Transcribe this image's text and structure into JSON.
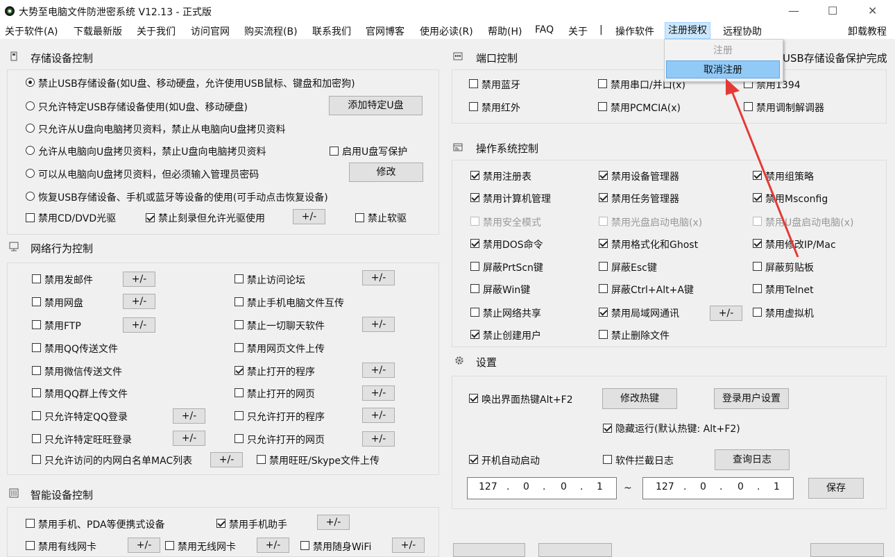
{
  "window": {
    "title": "大势至电脑文件防泄密系统 V12.13 - 正式版",
    "controls": {
      "minimize": "—",
      "maximize": "☐",
      "close": "✕"
    }
  },
  "menubar": {
    "items": [
      "关于软件(A)",
      "下载最新版",
      "关于我们",
      "访问官网",
      "购买流程(B)",
      "联系我们",
      "官网博客",
      "使用必读(R)",
      "帮助(H)",
      "FAQ",
      "关于",
      "|",
      "操作软件",
      "注册授权",
      "远程协助"
    ],
    "right_item": "卸载教程"
  },
  "dropdown": {
    "items": [
      "注册",
      "取消注册"
    ],
    "highlighted": "取消注册",
    "disabled": "注册"
  },
  "status_text": "USB存储设备保护完成",
  "storage": {
    "title": "存储设备控制",
    "radios": [
      "禁止USB存储设备(如U盘、移动硬盘，允许使用USB鼠标、键盘和加密狗)",
      "只允许特定USB存储设备使用(如U盘、移动硬盘)",
      "只允许从U盘向电脑拷贝资料，禁止从电脑向U盘拷贝资料",
      "允许从电脑向U盘拷贝资料，禁止U盘向电脑拷贝资料",
      "可以从电脑向U盘拷贝资料，但必须输入管理员密码",
      "恢复USB存储设备、手机或蓝牙等设备的使用(可手动点击恢复设备)"
    ],
    "add_usb_button": "添加特定U盘",
    "write_protect": "启用U盘写保护",
    "modify_button": "修改",
    "cd_dvd": "禁用CD/DVD光驱",
    "burn": "禁止刻录但允许光驱使用",
    "floppy": "禁止软驱",
    "plus_minus": "+/-"
  },
  "network": {
    "title": "网络行为控制",
    "left": [
      "禁用发邮件",
      "禁用网盘",
      "禁用FTP",
      "禁用QQ传送文件",
      "禁用微信传送文件",
      "禁用QQ群上传文件",
      "只允许特定QQ登录",
      "只允许特定旺旺登录",
      "只允许访问的内网白名单MAC列表"
    ],
    "right": [
      "禁止访问论坛",
      "禁止手机电脑文件互传",
      "禁止一切聊天软件",
      "禁用网页文件上传",
      "禁止打开的程序",
      "禁止打开的网页",
      "只允许打开的程序",
      "只允许打开的网页",
      "禁用旺旺/Skype文件上传"
    ]
  },
  "smart": {
    "title": "智能设备控制",
    "row1": [
      "禁用手机、PDA等便携式设备",
      "禁用手机助手"
    ],
    "row2": [
      "禁用有线网卡",
      "禁用无线网卡",
      "禁用随身WiFi"
    ]
  },
  "port": {
    "title": "端口控制",
    "items": [
      "禁用蓝牙",
      "禁用串口/并口(x)",
      "禁用1394",
      "禁用红外",
      "禁用PCMCIA(x)",
      "禁用调制解调器"
    ]
  },
  "os": {
    "title": "操作系统控制",
    "items": [
      [
        "禁用注册表",
        "禁用设备管理器",
        "禁用组策略"
      ],
      [
        "禁用计算机管理",
        "禁用任务管理器",
        "禁用Msconfig"
      ],
      [
        "禁用安全模式",
        "禁用光盘启动电脑(x)",
        "禁用U盘启动电脑(x)"
      ],
      [
        "禁用DOS命令",
        "禁用格式化和Ghost",
        "禁用修改IP/Mac"
      ],
      [
        "屏蔽PrtScn键",
        "屏蔽Esc键",
        "屏蔽剪贴板"
      ],
      [
        "屏蔽Win键",
        "屏蔽Ctrl+Alt+A键",
        "禁用Telnet"
      ],
      [
        "禁止网络共享",
        "禁用局域网通讯",
        "禁用虚拟机"
      ],
      [
        "禁止创建用户",
        "禁止删除文件"
      ]
    ]
  },
  "settings": {
    "title": "设置",
    "hotkey": "唤出界面热键Alt+F2",
    "modify_hotkey": "修改热键",
    "login_settings": "登录用户设置",
    "hide_run": "隐藏运行(默认热键: Alt+F2)",
    "autostart": "开机自动启动",
    "intercept_log": "软件拦截日志",
    "query_log": "查询日志",
    "ip_start": [
      "127",
      "0",
      "0",
      "1"
    ],
    "ip_end": [
      "127",
      "0",
      "0",
      "1"
    ],
    "tilde": "~",
    "save": "保存"
  },
  "colors": {
    "accent": "#cce8ff",
    "dropdown_highlight": "#91c9f7",
    "arrow": "#e53935"
  }
}
